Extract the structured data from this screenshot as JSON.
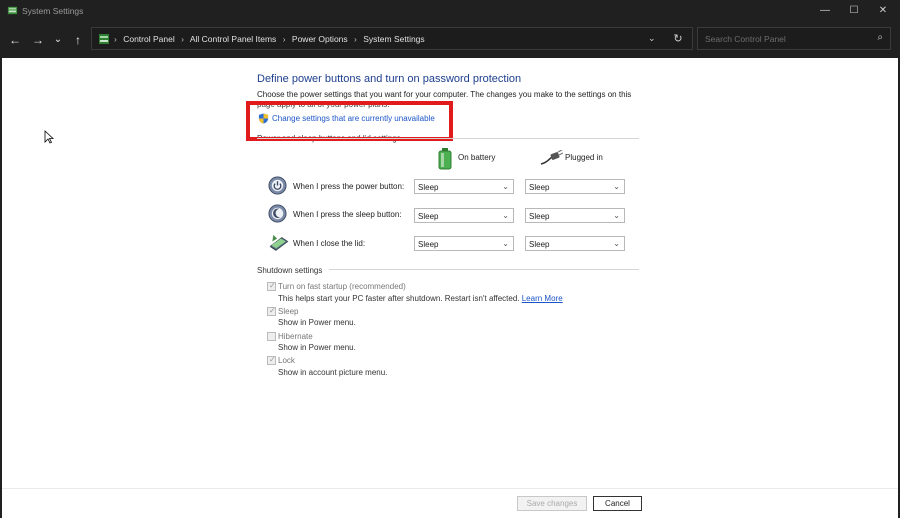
{
  "window": {
    "title": "System Settings",
    "minimize": "—",
    "maximize": "☐",
    "close": "✕"
  },
  "nav": {
    "back": "←",
    "forward": "→",
    "recent": "⌄",
    "up": "↑",
    "dropdown": "⌄",
    "refresh": "↻",
    "breadcrumbs": [
      "Control Panel",
      "All Control Panel Items",
      "Power Options",
      "System Settings"
    ],
    "separator": "›"
  },
  "search": {
    "placeholder": "Search Control Panel",
    "icon": "⌕"
  },
  "page": {
    "heading": "Define power buttons and turn on password protection",
    "description": "Choose the power settings that you want for your computer. The changes you make to the settings on this",
    "description_cont": "page apply to all of your power plans.",
    "change_link": "Change settings that are currently unavailable",
    "section_power": "Power and sleep buttons and lid settings",
    "col_battery": "On battery",
    "col_plugged": "Plugged in",
    "rows": [
      {
        "label": "When I press the power button:",
        "battery": "Sleep",
        "plugged": "Sleep"
      },
      {
        "label": "When I press the sleep button:",
        "battery": "Sleep",
        "plugged": "Sleep"
      },
      {
        "label": "When I close the lid:",
        "battery": "Sleep",
        "plugged": "Sleep"
      }
    ],
    "section_shutdown": "Shutdown settings",
    "shutdown_options": [
      {
        "title": "Turn on fast startup (recommended)",
        "sub": "This helps start your PC faster after shutdown. Restart isn't affected.",
        "link": "Learn More",
        "checked": true
      },
      {
        "title": "Sleep",
        "sub": "Show in Power menu.",
        "checked": true
      },
      {
        "title": "Hibernate",
        "sub": "Show in Power menu.",
        "checked": false
      },
      {
        "title": "Lock",
        "sub": "Show in account picture menu.",
        "checked": true
      }
    ],
    "caret": "⌄"
  },
  "footer": {
    "save": "Save changes",
    "cancel": "Cancel"
  },
  "colors": {
    "heading": "#1e3f8f",
    "link": "#1c55c9",
    "highlight": "#e11b1b",
    "chrome": "#202020"
  },
  "icons": {
    "app": "control-panel-icon",
    "shield": "uac-shield-icon",
    "battery": "battery-icon",
    "plug": "plug-icon",
    "power": "power-button-icon",
    "sleep": "sleep-button-icon",
    "lid": "laptop-lid-icon"
  }
}
